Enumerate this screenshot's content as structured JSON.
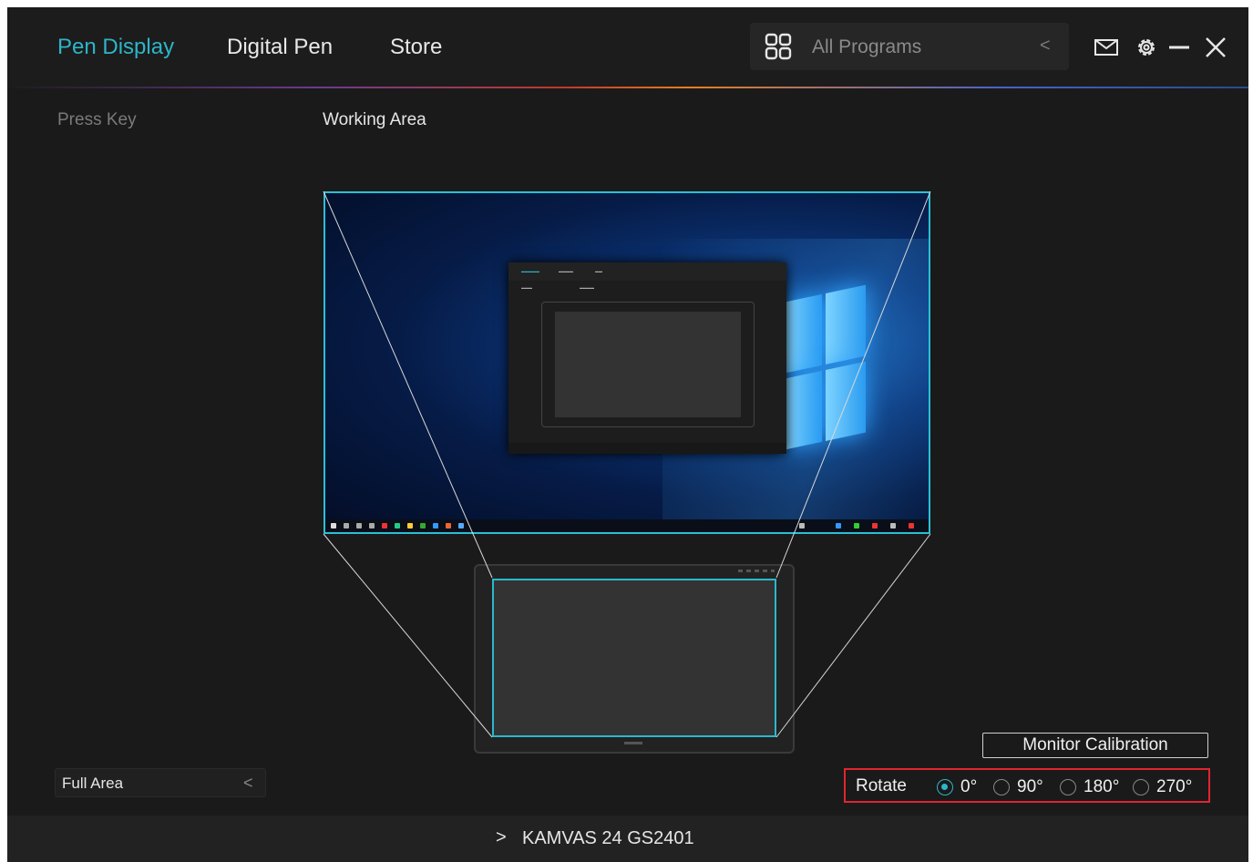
{
  "nav": {
    "tabs": [
      "Pen Display",
      "Digital Pen",
      "Store"
    ],
    "active_tab": "Pen Display"
  },
  "programs": {
    "label": "All Programs",
    "icon": "grid-icon",
    "chevron": "<"
  },
  "window_controls": {
    "icons": [
      "mail-icon",
      "gear-icon",
      "minimize-icon",
      "close-icon"
    ]
  },
  "subnav": {
    "press_key": "Press Key",
    "working_area": "Working Area"
  },
  "area_select": {
    "value": "Full Area",
    "chevron": "<"
  },
  "monitor_calibration": "Monitor Calibration",
  "rotate": {
    "label": "Rotate",
    "options": [
      "0°",
      "90°",
      "180°",
      "270°"
    ],
    "selected": "0°"
  },
  "footer": {
    "chevron": ">",
    "device": "KAMVAS 24 GS2401"
  },
  "colors": {
    "accent": "#2db5c8",
    "highlight_border": "#e0262e",
    "background": "#1a1a1a"
  }
}
